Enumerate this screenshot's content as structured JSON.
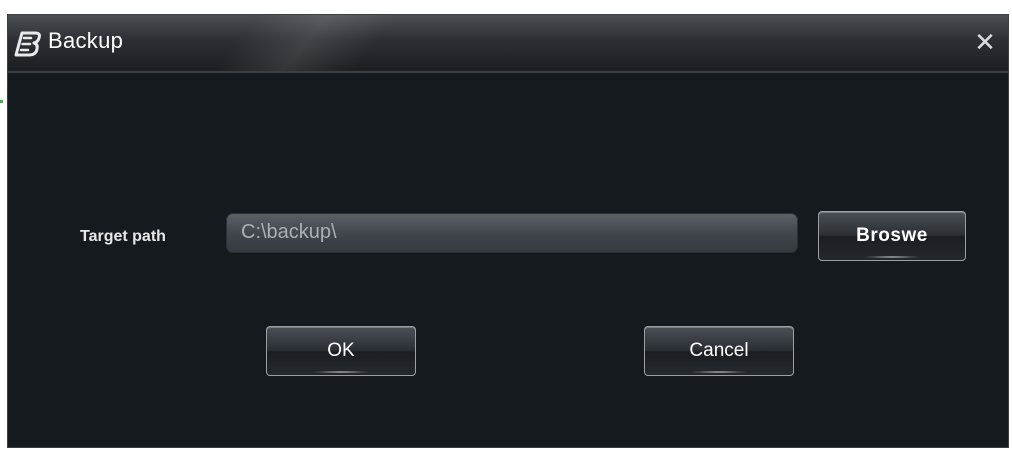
{
  "window": {
    "title": "Backup",
    "close_symbol": "✕",
    "app_icon": "backup-b-icon"
  },
  "form": {
    "target_path_label": "Target path",
    "target_path_value": "C:\\backup\\",
    "browse_label": "Broswe"
  },
  "actions": {
    "ok_label": "OK",
    "cancel_label": "Cancel"
  },
  "colors": {
    "window_bg": "#151a1e",
    "titlebar_top": "#4a4f54",
    "text": "#ffffff",
    "input_text": "#a9b0b6"
  }
}
